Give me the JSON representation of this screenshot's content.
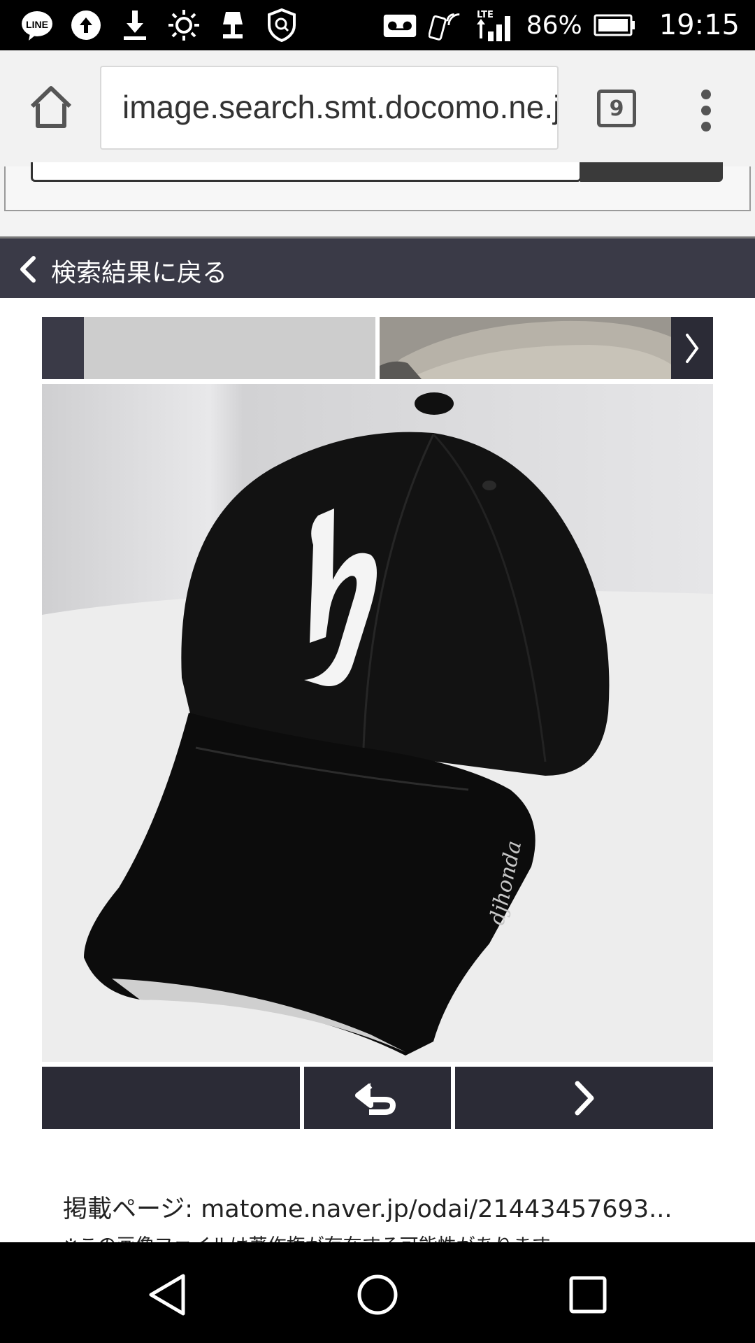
{
  "status_bar": {
    "battery": "86%",
    "time": "19:15",
    "network": "LTE",
    "left_icons": [
      "line-icon",
      "upload-icon",
      "download-icon",
      "brightness-icon",
      "lamp-icon",
      "shield-icon"
    ],
    "right_icons": [
      "voicemail-icon",
      "nfc-icon",
      "signal-icon",
      "battery-icon"
    ]
  },
  "browser": {
    "url": "image.search.smt.docomo.ne.jp",
    "tab_count": "9"
  },
  "back_bar": {
    "label": "検索結果に戻る"
  },
  "image_viewer": {
    "alt": "black baseball cap",
    "cap_logo_text": "h",
    "cap_side_text": "djhonda"
  },
  "caption": {
    "source_label": "掲載ページ: matome.naver.jp/odai/21443457693...",
    "notice": "※この画像ファイルは著作権が存在する可能性があります"
  },
  "colors": {
    "bar_dark": "#3a3a47",
    "button_dark": "#2b2b36"
  }
}
